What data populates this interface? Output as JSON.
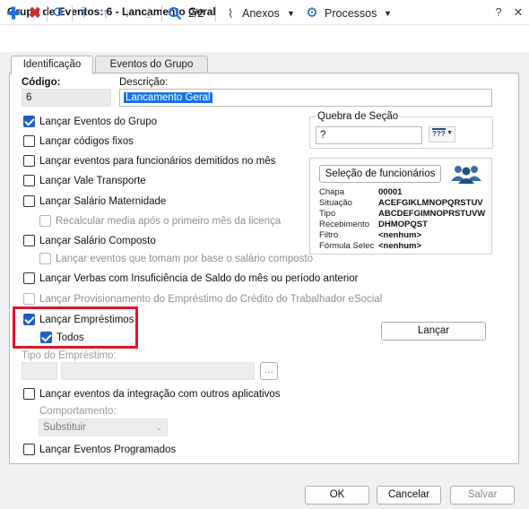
{
  "window": {
    "title": "Grupo de Eventos: 6 - Lancamento Geral"
  },
  "toolbar": {
    "page_indicator": "2/2",
    "attachments_label": "Anexos",
    "processes_label": "Processos"
  },
  "tabs": [
    {
      "label": "Identificação",
      "active": true
    },
    {
      "label": "Eventos do Grupo",
      "active": false
    }
  ],
  "form": {
    "codigo_label": "Código:",
    "codigo_value": "6",
    "descricao_label": "Descrição:",
    "descricao_value": "Lancamento Geral",
    "quebra_label": "Quebra de Seção",
    "quebra_value": "?",
    "quebra_icon_text": "???"
  },
  "checkboxes": {
    "eventos_grupo": {
      "label": "Lançar Eventos do Grupo",
      "checked": true
    },
    "codigos_fixos": {
      "label": "Lançar códigos fixos",
      "checked": false
    },
    "demitidos": {
      "label": "Lançar eventos para funcionários demitidos no mês",
      "checked": false
    },
    "vale_transporte": {
      "label": "Lançar Vale Transporte",
      "checked": false
    },
    "salario_maternidade": {
      "label": "Lançar Salário Maternidade",
      "checked": false
    },
    "recalcular_media": {
      "label": "Recalcular media após o primeiro mês da licença",
      "checked": false
    },
    "salario_composto": {
      "label": "Lançar Salário Composto",
      "checked": false
    },
    "eventos_base": {
      "label": "Lançar eventos que tomam por base o salário composto",
      "checked": false
    },
    "verbas_insuficiencia": {
      "label": "Lançar Verbas com Insuficiência de Saldo do mês ou período anterior",
      "checked": false
    },
    "provisionamento": {
      "label": "Lançar Provisionamento do Empréstimo do Crédito do Trabalhador eSocial",
      "checked": false
    },
    "emprestimos": {
      "label": "Lançar Empréstimos",
      "checked": true
    },
    "todos": {
      "label": "Todos",
      "checked": true
    },
    "integracao": {
      "label": "Lançar eventos da integração com outros aplicativos",
      "checked": false
    },
    "programados": {
      "label": "Lançar Eventos Programados",
      "checked": false
    }
  },
  "selection": {
    "button_label": "Seleção de funcionários",
    "rows": [
      {
        "key": "Chapa",
        "value": "00001"
      },
      {
        "key": "Situação",
        "value": "ACEFGIKLMNOPQRSTUV"
      },
      {
        "key": "Tipo",
        "value": "ABCDEFGIMNOPRSTUVW"
      },
      {
        "key": "Recebimento",
        "value": "DHMOPQST"
      },
      {
        "key": "Filtro",
        "value": "<nenhum>"
      },
      {
        "key": "Fórmula Selec",
        "value": "<nenhum>"
      }
    ]
  },
  "lancar_button": "Lançar",
  "tipo_emprestimo_label": "Tipo do Empréstimo:",
  "ellipsis_button": "...",
  "comportamento": {
    "label": "Comportamento:",
    "value": "Substituir"
  },
  "footer": {
    "ok": "OK",
    "cancel": "Cancelar",
    "save": "Salvar"
  },
  "colors": {
    "accent": "#1f5fbf",
    "highlight_box": "#e3142c",
    "add": "#1a73e8",
    "delete": "#d32f2f"
  }
}
